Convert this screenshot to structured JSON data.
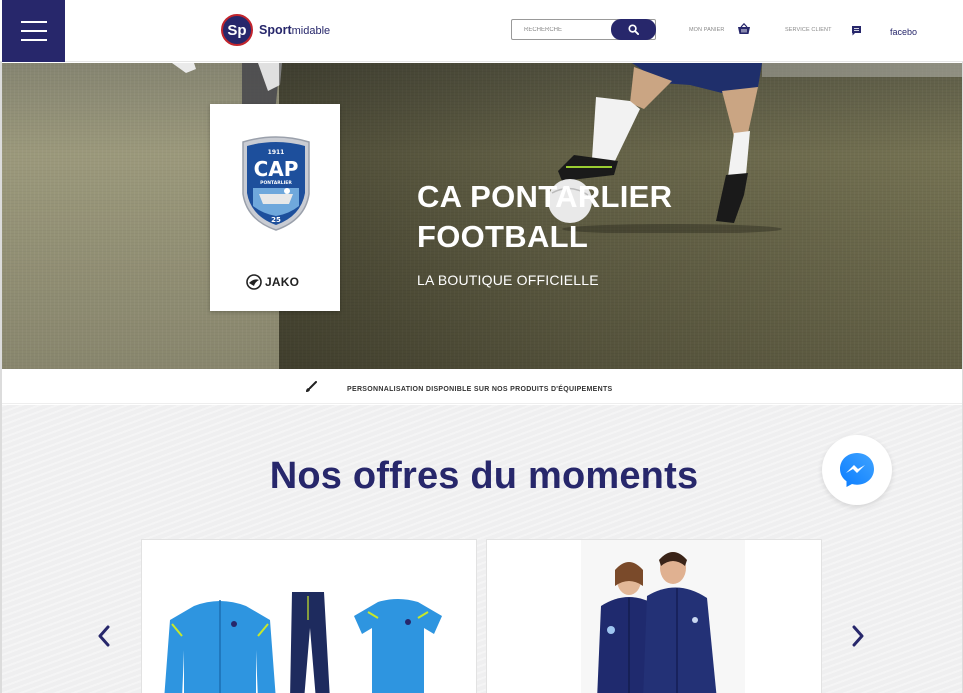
{
  "header": {
    "brand_short": "Sp",
    "brand_name_bold": "Sport",
    "brand_name_light": "midable",
    "search": {
      "placeholder": "RECHERCHE",
      "value": ""
    },
    "cart_label": "MON PANIER",
    "service_label": "SERVICE CLIENT",
    "facebook_label": "facebo"
  },
  "hero": {
    "title_line1": "CA PONTARLIER",
    "title_line2": "FOOTBALL",
    "subtitle": "LA BOUTIQUE OFFICIELLE",
    "crest": {
      "year": "1911",
      "name": "CAP",
      "city": "PONTARLIER",
      "number": "25"
    },
    "partner": "JAKO"
  },
  "banner": {
    "text": "PERSONNALISATION DISPONIBLE SUR NOS PRODUITS D'ÉQUIPEMENTS"
  },
  "offers": {
    "title": "Nos offres du moments"
  },
  "colors": {
    "brand_navy": "#27276b",
    "brand_red": "#c2252d",
    "sky_blue": "#2e95e0",
    "messenger_blue": "#1f7cf2"
  },
  "icons": {
    "menu": "hamburger-icon",
    "search": "search-icon",
    "cart": "basket-icon",
    "service": "chat-icon",
    "banner": "brush-icon",
    "messenger": "messenger-icon",
    "prev": "chevron-left-icon",
    "next": "chevron-right-icon"
  }
}
